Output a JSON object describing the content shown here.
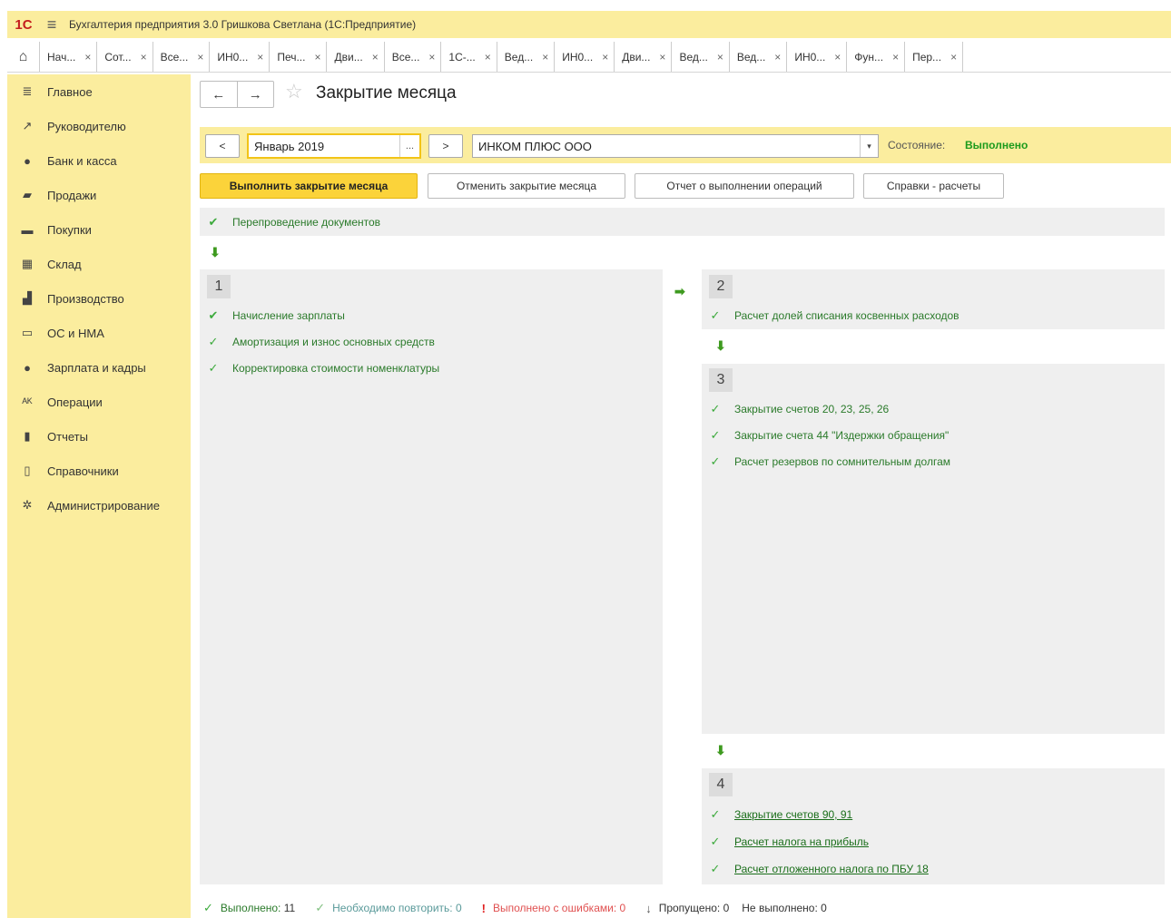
{
  "app": {
    "logo": "1С",
    "title": "Бухгалтерия предприятия 3.0 Гришкова Светлана  (1С:Предприятие)"
  },
  "tabs": [
    {
      "label": "Нач..."
    },
    {
      "label": "Сот..."
    },
    {
      "label": "Все..."
    },
    {
      "label": "ИН0..."
    },
    {
      "label": "Печ..."
    },
    {
      "label": "Дви..."
    },
    {
      "label": "Все..."
    },
    {
      "label": "1С-..."
    },
    {
      "label": "Вед..."
    },
    {
      "label": "ИН0..."
    },
    {
      "label": "Дви..."
    },
    {
      "label": "Вед..."
    },
    {
      "label": "Вед..."
    },
    {
      "label": "ИН0..."
    },
    {
      "label": "Фун..."
    },
    {
      "label": "Пер..."
    }
  ],
  "sidebar": {
    "items": [
      {
        "label": "Главное",
        "icon": "≣"
      },
      {
        "label": "Руководителю",
        "icon": "↗"
      },
      {
        "label": "Банк и касса",
        "icon": "●"
      },
      {
        "label": "Продажи",
        "icon": "▰"
      },
      {
        "label": "Покупки",
        "icon": "▬"
      },
      {
        "label": "Склад",
        "icon": "▦"
      },
      {
        "label": "Производство",
        "icon": "▟"
      },
      {
        "label": "ОС и НМА",
        "icon": "▭"
      },
      {
        "label": "Зарплата и кадры",
        "icon": "●"
      },
      {
        "label": "Операции",
        "icon": "ᴬᴷ"
      },
      {
        "label": "Отчеты",
        "icon": "▮"
      },
      {
        "label": "Справочники",
        "icon": "▯"
      },
      {
        "label": "Администрирование",
        "icon": "✲"
      }
    ]
  },
  "header": {
    "back": "←",
    "forward": "→",
    "title": "Закрытие месяца"
  },
  "period": {
    "prev": "<",
    "next": ">",
    "value": "Январь 2019",
    "choose": "...",
    "organization": "ИНКОМ ПЛЮС ООО",
    "state_label": "Состояние:",
    "state_value": "Выполнено"
  },
  "actions": {
    "run": "Выполнить закрытие месяца",
    "cancel": "Отменить закрытие месяца",
    "report": "Отчет о выполнении операций",
    "refs": "Справки - расчеты"
  },
  "pre": {
    "label": "Перепроведение документов"
  },
  "stages": {
    "s1": {
      "number": "1",
      "items": [
        "Начисление зарплаты",
        "Амортизация и износ основных средств",
        "Корректировка стоимости номенклатуры"
      ]
    },
    "s2": {
      "number": "2",
      "items": [
        "Расчет долей списания косвенных расходов"
      ]
    },
    "s3": {
      "number": "3",
      "items": [
        "Закрытие счетов 20, 23, 25, 26",
        "Закрытие счета 44 \"Издержки обращения\"",
        "Расчет резервов по сомнительным долгам"
      ]
    },
    "s4": {
      "number": "4",
      "items": [
        "Закрытие счетов 90, 91",
        "Расчет налога на прибыль",
        "Расчет отложенного налога по ПБУ 18"
      ]
    }
  },
  "footer": {
    "done_label": "Выполнено:",
    "done_count": "11",
    "repeat_label": "Необходимо повторить:",
    "repeat_count": "0",
    "errors_label": "Выполнено с ошибками:",
    "errors_count": "0",
    "skipped_label": "Пропущено:",
    "skipped_count": "0",
    "not_done_label": "Не выполнено:",
    "not_done_count": "0"
  },
  "colors": {
    "accent_yellow": "#fbed9e",
    "primary_button": "#fbd33a",
    "ok_green": "#1c9b1c",
    "error_red": "#e05050",
    "muted_teal": "#5a9a9a"
  }
}
